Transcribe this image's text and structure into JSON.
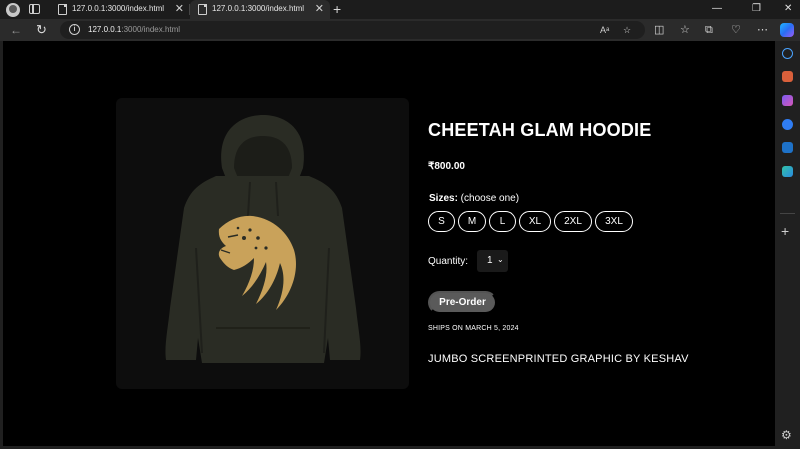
{
  "tabs": [
    {
      "title": "127.0.0.1:3000/index.html",
      "active": false
    },
    {
      "title": "127.0.0.1:3000/index.html",
      "active": true
    }
  ],
  "address": {
    "host": "127.0.0.1",
    "path": ":3000/index.html"
  },
  "product": {
    "name": "CHEETAH GLAM HOODIE",
    "price": "₹800.00",
    "sizes_label": "Sizes:",
    "sizes_hint": " (choose one)",
    "sizes": [
      "S",
      "M",
      "L",
      "XL",
      "2XL",
      "3XL"
    ],
    "quantity_label": "Quantity:",
    "quantity_value": "1",
    "preorder_label": "Pre-Order",
    "ships": "SHIPS ON MARCH 5, 2024",
    "description": "JUMBO SCREENPRINTED GRAPHIC BY KESHAV"
  },
  "colors": {
    "page_bg": "#000000",
    "hoodie": "#2a2c24",
    "graphic": "#c9a25a",
    "button_gray": "#5a5a5a"
  },
  "icons": {
    "sidebar": [
      "search-icon",
      "shopping-icon",
      "games-icon",
      "copilot-icon",
      "outlook-icon",
      "drop-icon",
      "add-icon",
      "settings-icon"
    ]
  }
}
